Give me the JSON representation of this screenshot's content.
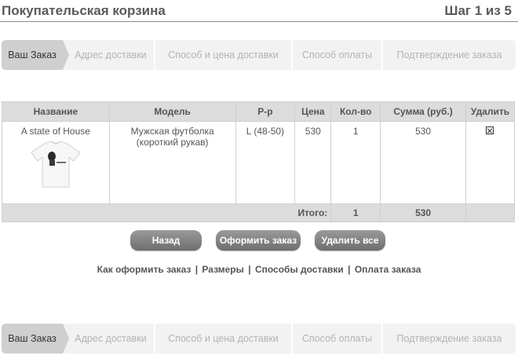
{
  "header": {
    "title": "Покупательская корзина",
    "step_text": "Шаг 1 из 5"
  },
  "steps": [
    {
      "label": "Ваш Заказ",
      "active": true
    },
    {
      "label": "Адрес доставки",
      "active": false
    },
    {
      "label": "Способ и цена доставки",
      "active": false
    },
    {
      "label": "Способ оплаты",
      "active": false
    },
    {
      "label": "Подтверждение заказа",
      "active": false
    }
  ],
  "table": {
    "columns": [
      "Название",
      "Модель",
      "Р-р",
      "Цена",
      "Кол-во",
      "Сумма (руб.)",
      "Удалить"
    ],
    "rows": [
      {
        "name": "A state of House",
        "model": "Мужская футболка (короткий рукав)",
        "size": "L (48-50)",
        "price": "530",
        "qty": "1",
        "sum": "530",
        "delete_checked": true,
        "image": "tshirt-icon"
      }
    ],
    "total": {
      "label": "Итого:",
      "qty": "1",
      "sum": "530"
    }
  },
  "buttons": {
    "back": "Назад",
    "order": "Оформить заказ",
    "clear": "Удалить все"
  },
  "links": {
    "how_to_order": "Как оформить заказ",
    "sizes": "Размеры",
    "delivery": "Способы доставки",
    "payment": "Оплата заказа",
    "separator": "|"
  },
  "colors": {
    "active_step": "#cfcfcf",
    "inactive_step": "#f2f2f2",
    "header_row": "#dcdcdc",
    "button": "#7f7f7f"
  }
}
